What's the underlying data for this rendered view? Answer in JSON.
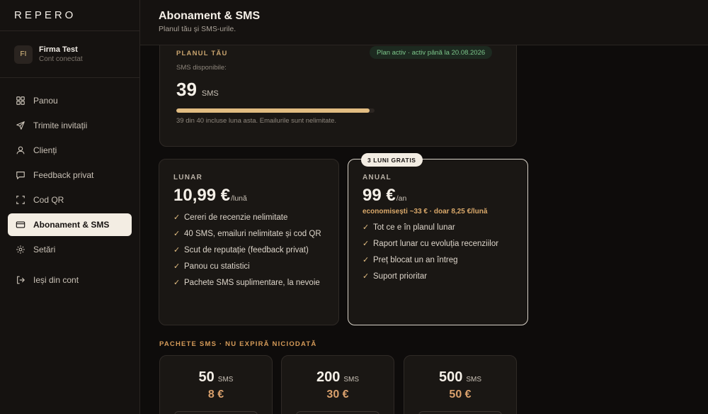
{
  "brand": "REPERO",
  "account": {
    "initials": "FI",
    "name": "Firma Test",
    "status": "Cont conectat"
  },
  "nav": {
    "items": [
      {
        "label": "Panou",
        "icon": "grid-icon"
      },
      {
        "label": "Trimite invitații",
        "icon": "send-icon"
      },
      {
        "label": "Clienți",
        "icon": "user-icon"
      },
      {
        "label": "Feedback privat",
        "icon": "message-icon"
      },
      {
        "label": "Cod QR",
        "icon": "qr-icon"
      },
      {
        "label": "Abonament & SMS",
        "icon": "card-icon",
        "active": true
      },
      {
        "label": "Setări",
        "icon": "gear-icon"
      }
    ],
    "logout": {
      "label": "Ieși din cont",
      "icon": "logout-icon"
    }
  },
  "header": {
    "title": "Abonament & SMS",
    "subtitle": "Planul tău și SMS-urile."
  },
  "plan": {
    "eyebrow": "PLANUL TĂU",
    "badge": "Plan activ · activ până la 20.08.2026",
    "sms_label": "SMS disponibile:",
    "sms_count": "39",
    "sms_unit": "SMS",
    "progress_fraction": 0.975,
    "note": "39 din 40 incluse luna asta. Emailurile sunt nelimitate."
  },
  "pricing": {
    "monthly": {
      "eyebrow": "LUNAR",
      "price": "10,99 €",
      "per": "/lună",
      "features": [
        "Cereri de recenzie nelimitate",
        "40 SMS, emailuri nelimitate și cod QR",
        "Scut de reputație (feedback privat)",
        "Panou cu statistici",
        "Pachete SMS suplimentare, la nevoie"
      ]
    },
    "annual": {
      "badge": "3 LUNI GRATIS",
      "eyebrow": "ANUAL",
      "price": "99 €",
      "per": "/an",
      "savings": "economisești ~33 € · doar 8,25 €/lună",
      "features": [
        "Tot ce e în planul lunar",
        "Raport lunar cu evoluția recenziilor",
        "Preț blocat un an întreg",
        "Suport prioritar"
      ]
    }
  },
  "packs": {
    "title": "PACHETE SMS · NU EXPIRĂ NICIODATĂ",
    "items": [
      {
        "qty": "50",
        "unit": "SMS",
        "price": "8 €"
      },
      {
        "qty": "200",
        "unit": "SMS",
        "price": "30 €"
      },
      {
        "qty": "500",
        "unit": "SMS",
        "price": "50 €"
      }
    ]
  },
  "colors": {
    "accent": "#e2bd82",
    "active_green": "#7cc58a",
    "price_orange": "#d9a06c",
    "background": "#0e0c0b",
    "card": "#1a1714"
  }
}
